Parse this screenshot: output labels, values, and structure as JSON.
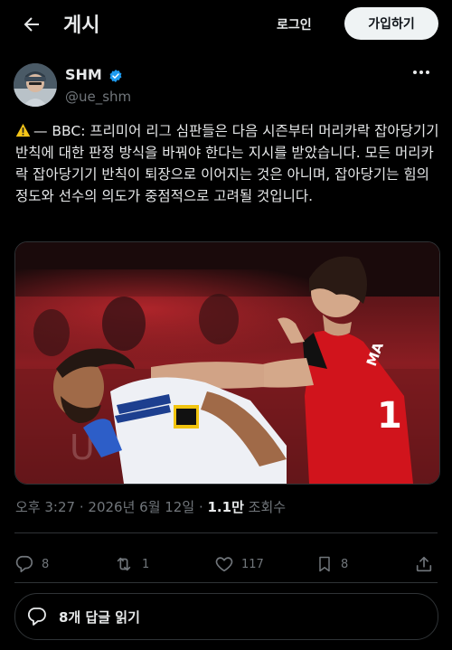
{
  "header": {
    "title": "게시",
    "login_label": "로그인",
    "signup_label": "가입하기"
  },
  "author": {
    "name": "SHM",
    "handle": "@ue_shm",
    "verified": true,
    "verified_color": "#1d9bf0"
  },
  "post": {
    "text": "— BBC: 프리미어 리그 심판들은 다음 시즌부터 머리카락 잡아당기기 반칙에 대한 판정 방식을 바꿔야 한다는 지시를 받았습니다. 모든 머리카락 잡아당기기 반칙이 퇴장으로 이어지는 것은 아니며, 잡아당기는 힘의 정도와 선수의 의도가 중점적으로 고려될 것입니다.",
    "media": {
      "player_kit_text": "MA",
      "player_number": "1"
    }
  },
  "meta": {
    "time": "오후 3:27",
    "separator": "·",
    "date": "2026년 6월 12일",
    "views_count": "1.1만",
    "views_label": "조회수"
  },
  "actions": {
    "replies": "8",
    "reposts": "1",
    "likes": "117",
    "bookmarks": "8"
  },
  "replies_button": {
    "label": "8개 답글 읽기"
  },
  "colors": {
    "background": "#000000",
    "text": "#e7e9ea",
    "muted": "#71767b",
    "border": "#2f3336",
    "accent": "#1d9bf0",
    "button_bg": "#eff3f4"
  }
}
